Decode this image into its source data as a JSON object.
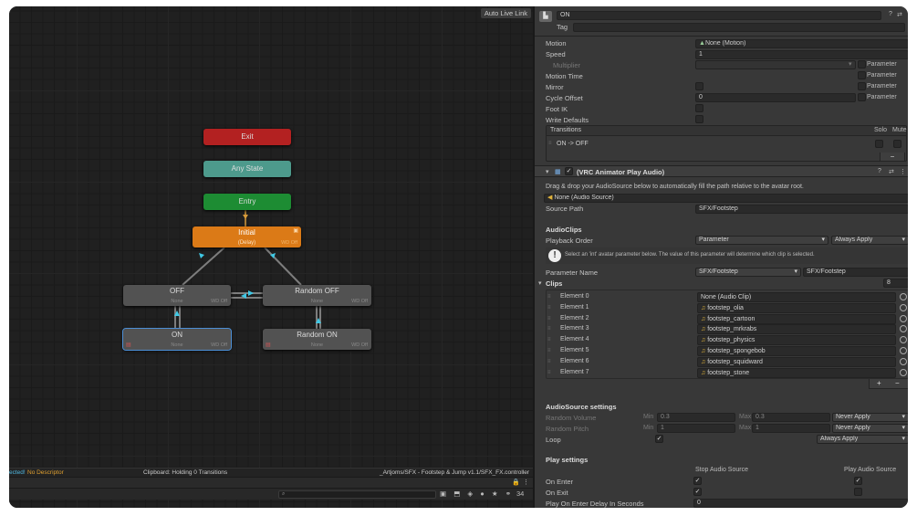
{
  "graph": {
    "auto_live_link": "Auto Live Link",
    "nodes": {
      "exit": {
        "name": "Exit"
      },
      "any_state": {
        "name": "Any State"
      },
      "entry": {
        "name": "Entry"
      },
      "initial": {
        "name": "Initial",
        "sub": "(Delay)",
        "wd": "WD Off"
      },
      "off": {
        "name": "OFF",
        "sub": "None",
        "wd": "WD Off"
      },
      "random_off": {
        "name": "Random OFF",
        "sub": "None",
        "wd": "WD Off"
      },
      "on": {
        "name": "ON",
        "sub": "None",
        "wd": "WD Off"
      },
      "random_on": {
        "name": "Random ON",
        "sub": "None",
        "wd": "WD Off"
      }
    },
    "status": {
      "selected": "ected!",
      "descriptor": "No Descriptor",
      "clipboard": "Clipboard: Holding 0 Transitions",
      "path": "_Artjoms/SFX - Footstep & Jump v1.1/SFX_FX.controller"
    },
    "toolbar": {
      "count": "34"
    },
    "colors": {
      "exit": "#b32121",
      "any": "#4d9a8c",
      "entry": "#1d8c33",
      "initial": "#db7a17",
      "transition": "#3fc7e4"
    }
  },
  "inspector": {
    "state_name": "ON",
    "tag_label": "Tag",
    "motion": {
      "label": "Motion",
      "value": "None (Motion)"
    },
    "speed": {
      "label": "Speed",
      "value": "1"
    },
    "multiplier": {
      "label": "Multiplier"
    },
    "motion_time": {
      "label": "Motion Time"
    },
    "mirror": {
      "label": "Mirror"
    },
    "cycle_offset": {
      "label": "Cycle Offset",
      "value": "0"
    },
    "foot_ik": {
      "label": "Foot IK"
    },
    "write_defaults": {
      "label": "Write Defaults"
    },
    "parameter_label": "Parameter",
    "transitions": {
      "header": "Transitions",
      "solo": "Solo",
      "mute": "Mute",
      "items": [
        "ON -> OFF"
      ]
    },
    "behaviour": {
      "title": "(VRC Animator Play Audio)",
      "drag_hint": "Drag & drop your AudioSource below to automatically fill the path relative to the avatar root.",
      "audio_source": "None (Audio Source)",
      "source_path": {
        "label": "Source Path",
        "value": "SFX/Footstep"
      },
      "audioclips_header": "AudioClips",
      "playback_order": {
        "label": "Playback Order",
        "value": "Parameter",
        "apply": "Always Apply"
      },
      "info": "Select an 'int' avatar parameter below. The value of this parameter will determine which clip is selected.",
      "parameter_name": {
        "label": "Parameter Name",
        "dropdown": "SFX/Footstep",
        "value": "SFX/Footstep"
      },
      "clips": {
        "label": "Clips",
        "count": "8",
        "elements": [
          {
            "label": "Element 0",
            "value": "None (Audio Clip)"
          },
          {
            "label": "Element 1",
            "value": "footstep_olia"
          },
          {
            "label": "Element 2",
            "value": "footstep_cartoon"
          },
          {
            "label": "Element 3",
            "value": "footstep_mrkrabs"
          },
          {
            "label": "Element 4",
            "value": "footstep_physics"
          },
          {
            "label": "Element 5",
            "value": "footstep_spongebob"
          },
          {
            "label": "Element 6",
            "value": "footstep_squidward"
          },
          {
            "label": "Element 7",
            "value": "footstep_stone"
          }
        ]
      },
      "audiosource_settings": {
        "header": "AudioSource settings",
        "random_volume": {
          "label": "Random Volume",
          "min_label": "Min",
          "min": "0.3",
          "max_label": "Max",
          "max": "0.3",
          "apply": "Never Apply"
        },
        "random_pitch": {
          "label": "Random Pitch",
          "min_label": "Min",
          "min": "1",
          "max_label": "Max",
          "max": "1",
          "apply": "Never Apply"
        },
        "loop": {
          "label": "Loop",
          "apply": "Always Apply"
        }
      },
      "play_settings": {
        "header": "Play settings",
        "stop_col": "Stop Audio Source",
        "play_col": "Play Audio Source",
        "on_enter": "On Enter",
        "on_exit": "On Exit",
        "delay": {
          "label": "Play On Enter Delay In Seconds",
          "value": "0"
        }
      }
    }
  }
}
